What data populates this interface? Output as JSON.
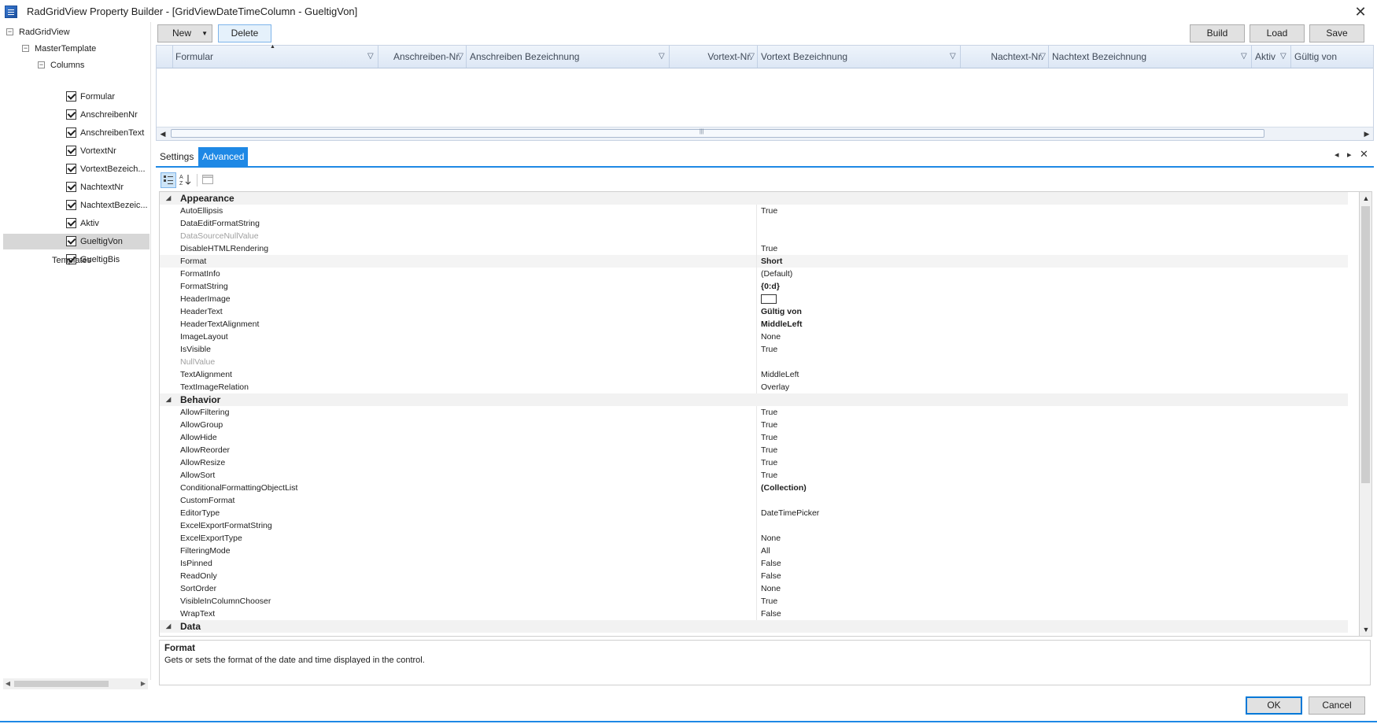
{
  "window": {
    "title": "RadGridView Property Builder - [GridViewDateTimeColumn - GueltigVon]",
    "close_label": "✕"
  },
  "tree": {
    "root": "RadGridView",
    "master": "MasterTemplate",
    "columns_label": "Columns",
    "columns": [
      "Formular",
      "AnschreibenNr",
      "AnschreibenText",
      "VortextNr",
      "VortextBezeich...",
      "NachtextNr",
      "NachtextBezeic...",
      "Aktiv",
      "GueltigVon",
      "GueltigBis"
    ],
    "selected": "GueltigVon",
    "templates_label": "Templates"
  },
  "toolbar": {
    "new_label": "New",
    "delete_label": "Delete",
    "build_label": "Build",
    "load_label": "Load",
    "save_label": "Save"
  },
  "grid": {
    "columns": [
      {
        "header": "Formular",
        "align": "left"
      },
      {
        "header": "Anschreiben-Nr.",
        "align": "right"
      },
      {
        "header": "Anschreiben Bezeichnung",
        "align": "left"
      },
      {
        "header": "Vortext-Nr.",
        "align": "right"
      },
      {
        "header": "Vortext Bezeichnung",
        "align": "left"
      },
      {
        "header": "Nachtext-Nr.",
        "align": "right"
      },
      {
        "header": "Nachtext Bezeichnung",
        "align": "left"
      },
      {
        "header": "Aktiv",
        "align": "left"
      },
      {
        "header": "Gültig von",
        "align": "left"
      }
    ]
  },
  "tabs": {
    "settings_label": "Settings",
    "advanced_label": "Advanced"
  },
  "properties": {
    "categories": [
      {
        "name": "Appearance",
        "rows": [
          {
            "name": "AutoEllipsis",
            "value": "True"
          },
          {
            "name": "DataEditFormatString",
            "value": ""
          },
          {
            "name": "DataSourceNullValue",
            "value": "",
            "disabled": true
          },
          {
            "name": "DisableHTMLRendering",
            "value": "True"
          },
          {
            "name": "Format",
            "value": "Short",
            "bold": true,
            "highlight": true
          },
          {
            "name": "FormatInfo",
            "value": "(Default)"
          },
          {
            "name": "FormatString",
            "value": "{0:d}",
            "bold": true
          },
          {
            "name": "HeaderImage",
            "value": "",
            "swatch": true
          },
          {
            "name": "HeaderText",
            "value": "Gültig von",
            "bold": true
          },
          {
            "name": "HeaderTextAlignment",
            "value": "MiddleLeft",
            "bold": true
          },
          {
            "name": "ImageLayout",
            "value": "None"
          },
          {
            "name": "IsVisible",
            "value": "True"
          },
          {
            "name": "NullValue",
            "value": "",
            "disabled": true
          },
          {
            "name": "TextAlignment",
            "value": "MiddleLeft"
          },
          {
            "name": "TextImageRelation",
            "value": "Overlay"
          }
        ]
      },
      {
        "name": "Behavior",
        "rows": [
          {
            "name": "AllowFiltering",
            "value": "True"
          },
          {
            "name": "AllowGroup",
            "value": "True"
          },
          {
            "name": "AllowHide",
            "value": "True"
          },
          {
            "name": "AllowReorder",
            "value": "True"
          },
          {
            "name": "AllowResize",
            "value": "True"
          },
          {
            "name": "AllowSort",
            "value": "True"
          },
          {
            "name": "ConditionalFormattingObjectList",
            "value": "(Collection)",
            "bold": true
          },
          {
            "name": "CustomFormat",
            "value": ""
          },
          {
            "name": "EditorType",
            "value": "DateTimePicker"
          },
          {
            "name": "ExcelExportFormatString",
            "value": ""
          },
          {
            "name": "ExcelExportType",
            "value": "None"
          },
          {
            "name": "FilteringMode",
            "value": "All"
          },
          {
            "name": "IsPinned",
            "value": "False"
          },
          {
            "name": "ReadOnly",
            "value": "False"
          },
          {
            "name": "SortOrder",
            "value": "None"
          },
          {
            "name": "VisibleInColumnChooser",
            "value": "True"
          },
          {
            "name": "WrapText",
            "value": "False"
          }
        ]
      },
      {
        "name": "Data",
        "rows": []
      }
    ]
  },
  "help": {
    "title": "Format",
    "description": "Gets or sets the format of the date and time displayed in the control."
  },
  "footer": {
    "ok_label": "OK",
    "cancel_label": "Cancel"
  },
  "colors": {
    "accent": "#1e88e5",
    "selection": "#d7d7d7"
  }
}
